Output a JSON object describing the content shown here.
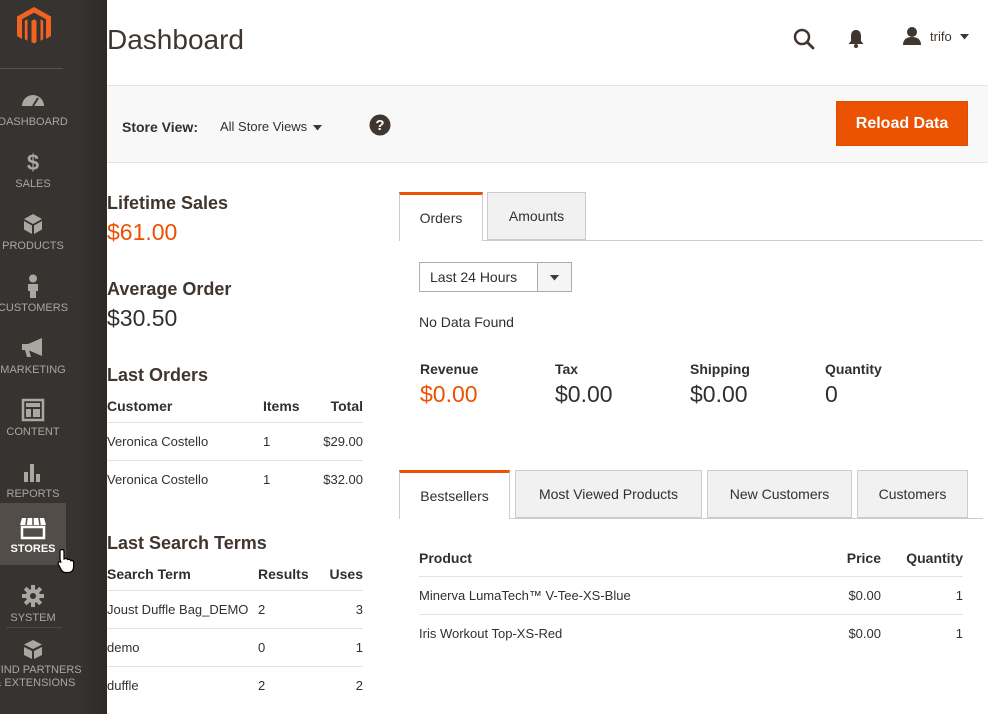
{
  "sidebar": {
    "items": [
      {
        "label": "DASHBOARD",
        "icon": "dashboard-icon"
      },
      {
        "label": "SALES",
        "icon": "dollar-icon"
      },
      {
        "label": "PRODUCTS",
        "icon": "box-icon"
      },
      {
        "label": "CUSTOMERS",
        "icon": "person-icon"
      },
      {
        "label": "MARKETING",
        "icon": "megaphone-icon"
      },
      {
        "label": "CONTENT",
        "icon": "layout-icon"
      },
      {
        "label": "REPORTS",
        "icon": "bar-chart-icon"
      },
      {
        "label": "STORES",
        "icon": "store-icon"
      },
      {
        "label": "SYSTEM",
        "icon": "gear-icon"
      },
      {
        "label_line1": "FIND PARTNERS",
        "label_line2": "& EXTENSIONS",
        "icon": "extensions-icon"
      }
    ]
  },
  "header": {
    "title": "Dashboard",
    "user": "trifo"
  },
  "storebar": {
    "label": "Store View:",
    "value": "All Store Views",
    "reload": "Reload Data"
  },
  "lifetime": {
    "title": "Lifetime Sales",
    "value": "$61.00"
  },
  "average": {
    "title": "Average Order",
    "value": "$30.50"
  },
  "last_orders": {
    "title": "Last Orders",
    "columns": [
      "Customer",
      "Items",
      "Total"
    ],
    "rows": [
      [
        "Veronica Costello",
        "1",
        "$29.00"
      ],
      [
        "Veronica Costello",
        "1",
        "$32.00"
      ]
    ]
  },
  "last_search": {
    "title": "Last Search Terms",
    "columns": [
      "Search Term",
      "Results",
      "Uses"
    ],
    "rows": [
      [
        "Joust Duffle Bag_DEMO",
        "2",
        "3"
      ],
      [
        "demo",
        "0",
        "1"
      ],
      [
        "duffle",
        "2",
        "2"
      ]
    ]
  },
  "chart_tabs": [
    "Orders",
    "Amounts"
  ],
  "period": "Last 24 Hours",
  "no_data": "No Data Found",
  "totals": [
    {
      "label": "Revenue",
      "value": "$0.00"
    },
    {
      "label": "Tax",
      "value": "$0.00"
    },
    {
      "label": "Shipping",
      "value": "$0.00"
    },
    {
      "label": "Quantity",
      "value": "0"
    }
  ],
  "product_tabs": [
    "Bestsellers",
    "Most Viewed Products",
    "New Customers",
    "Customers"
  ],
  "bestsellers": {
    "columns": [
      "Product",
      "Price",
      "Quantity"
    ],
    "rows": [
      [
        "Minerva LumaTech™ V-Tee-XS-Blue",
        "$0.00",
        "1"
      ],
      [
        "Iris Workout Top-XS-Red",
        "$0.00",
        "1"
      ]
    ]
  },
  "colors": {
    "accent": "#eb5202",
    "sidebar": "#373330"
  }
}
